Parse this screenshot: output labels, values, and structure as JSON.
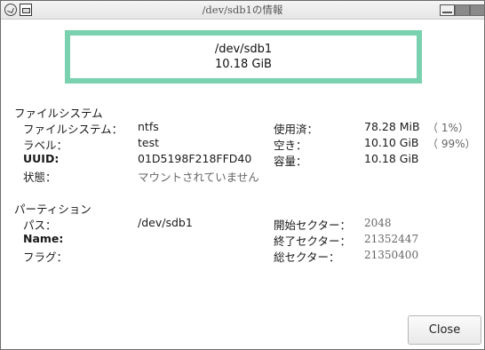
{
  "window": {
    "title": "/dev/sdb1の情報"
  },
  "summary": {
    "device": "/dev/sdb1",
    "size": "10.18 GiB",
    "bar_color": "#79d1b0"
  },
  "filesystem_section": {
    "title": "ファイルシステム",
    "labels": {
      "filesystem": "ファイルシステム：",
      "label": "ラベル：",
      "uuid": "UUID:",
      "status": "状態：",
      "used": "使用済：",
      "free": "空き：",
      "capacity": "容量："
    },
    "values": {
      "filesystem": "ntfs",
      "label": "test",
      "uuid": "01D5198F218FFD40",
      "status": "マウントされていません",
      "used": "78.28 MiB",
      "used_pct": "（ 1%）",
      "free": "10.10 GiB",
      "free_pct": "（ 99%）",
      "capacity": "10.18 GiB"
    }
  },
  "partition_section": {
    "title": "パーティション",
    "labels": {
      "path": "パス：",
      "name": "Name:",
      "flags": "フラグ：",
      "start_sector": "開始セクター：",
      "end_sector": "終了セクター：",
      "total_sectors": "総セクター："
    },
    "values": {
      "path": "/dev/sdb1",
      "name": "",
      "flags": "",
      "start_sector": "2048",
      "end_sector": "21352447",
      "total_sectors": "21350400"
    }
  },
  "buttons": {
    "close": "Close"
  }
}
